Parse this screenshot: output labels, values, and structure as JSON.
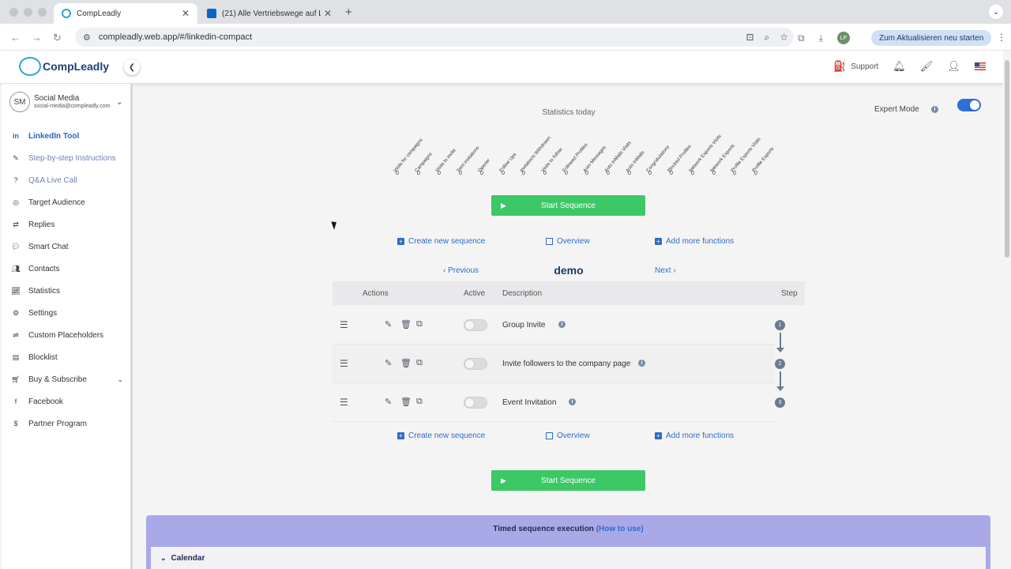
{
  "browser": {
    "tabs": [
      {
        "title": "CompLeadly",
        "active": true
      },
      {
        "title": "(21) Alle Vertriebswege auf Li",
        "active": false
      }
    ],
    "url": "compleadly.web.app/#/linkedin-compact",
    "update_button": "Zum Aktualisieren neu starten",
    "profile_initials": "LP"
  },
  "header": {
    "logo": "CompLeadly",
    "support_label": "Support"
  },
  "user": {
    "initials": "SM",
    "name": "Social Media",
    "email": "social-media@compleadly.com"
  },
  "sidebar": {
    "items": [
      {
        "label": "LinkedIn Tool",
        "icon": "linkedin-icon"
      },
      {
        "label": "Step-by-step Instructions",
        "icon": "walking-icon"
      },
      {
        "label": "Q&A Live Call",
        "icon": "question-icon"
      },
      {
        "label": "Target Audience",
        "icon": "target-icon"
      },
      {
        "label": "Replies",
        "icon": "replies-icon"
      },
      {
        "label": "Smart Chat",
        "icon": "chat-icon"
      },
      {
        "label": "Contacts",
        "icon": "contacts-icon"
      },
      {
        "label": "Statistics",
        "icon": "chart-icon"
      },
      {
        "label": "Settings",
        "icon": "gear-icon"
      },
      {
        "label": "Custom Placeholders",
        "icon": "placeholder-icon"
      },
      {
        "label": "Blocklist",
        "icon": "blocklist-icon"
      },
      {
        "label": "Buy & Subscribe",
        "icon": "cart-icon"
      },
      {
        "label": "Facebook",
        "icon": "facebook-icon"
      },
      {
        "label": "Partner Program",
        "icon": "dollar-icon"
      }
    ]
  },
  "main": {
    "stats_title": "Statistics today",
    "expert_mode_label": "Expert Mode",
    "stats": [
      {
        "label": "Visits for campaigns",
        "value": "0"
      },
      {
        "label": "Campaigns",
        "value": "0"
      },
      {
        "label": "Visits to invite",
        "value": "0"
      },
      {
        "label": "Sent invitations",
        "value": "0"
      },
      {
        "label": "Opener",
        "value": "0"
      },
      {
        "label": "Follow Ups",
        "value": "0"
      },
      {
        "label": "Invitations Withdrawn",
        "value": "0"
      },
      {
        "label": "Visits to follow",
        "value": "0"
      },
      {
        "label": "Followed Profiles",
        "value": "0"
      },
      {
        "label": "Auto Messages",
        "value": "0"
      },
      {
        "label": "Auto InMails Visits",
        "value": "0"
      },
      {
        "label": "Auto InMails",
        "value": "0"
      },
      {
        "label": "Congratulations",
        "value": "0"
      },
      {
        "label": "Blocked Profiles",
        "value": "0"
      },
      {
        "label": "Network Exports Visits",
        "value": "0"
      },
      {
        "label": "Network Exports",
        "value": "0"
      },
      {
        "label": "Profile Exports Visits",
        "value": "0"
      },
      {
        "label": "Profile Exports",
        "value": "0"
      }
    ],
    "start_sequence": "Start Sequence",
    "create_new_sequence": "Create new sequence",
    "overview": "Overview",
    "add_more_functions": "Add more functions",
    "previous": "Previous",
    "next": "Next",
    "sequence_name": "demo",
    "table_headers": {
      "actions": "Actions",
      "active": "Active",
      "description": "Description",
      "step": "Step"
    },
    "rows": [
      {
        "description": "Group Invite",
        "step": "1"
      },
      {
        "description": "Invite followers to the company page",
        "step": "2"
      },
      {
        "description": "Event Invitation",
        "step": "3"
      }
    ],
    "timed_title": "Timed sequence execution",
    "how_to_use": "(How to use)",
    "calendar": "Calendar"
  }
}
